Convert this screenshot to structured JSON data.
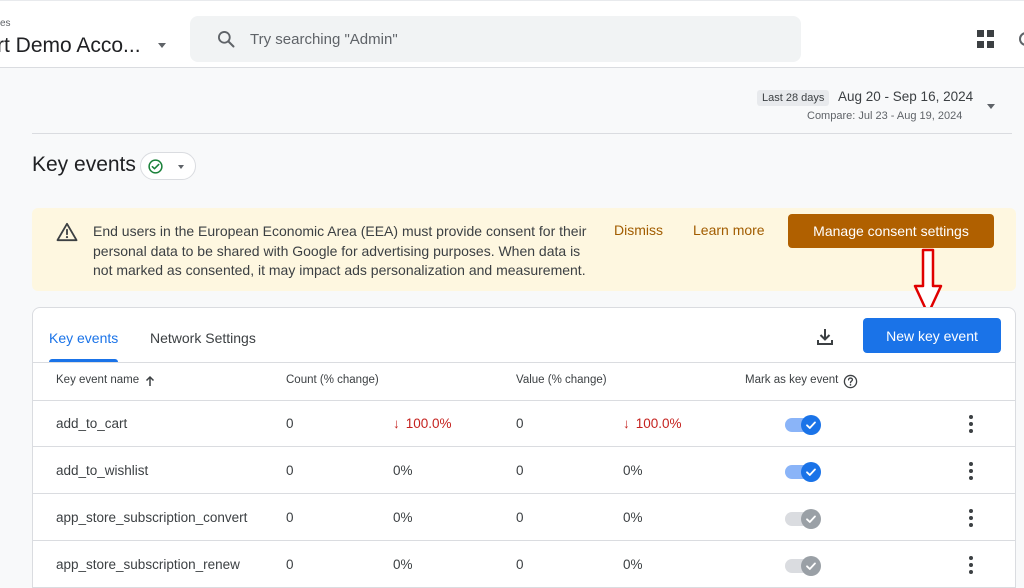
{
  "header": {
    "account_small": "es",
    "account_name": "rt Demo Acco...",
    "search_placeholder": "Try searching \"Admin\""
  },
  "date": {
    "chip": "Last 28 days",
    "range": "Aug 20 - Sep 16, 2024",
    "compare": "Compare: Jul 23 - Aug 19, 2024"
  },
  "page": {
    "title": "Key events"
  },
  "banner": {
    "text": "End users in the European Economic Area (EEA) must provide consent for their personal data to be shared with Google for advertising purposes. When data is not marked as consented, it may impact ads personalization and measurement.",
    "dismiss": "Dismiss",
    "learn_more": "Learn more",
    "manage": "Manage consent settings"
  },
  "tabs": {
    "key_events": "Key events",
    "network_settings": "Network Settings"
  },
  "new_button": "New key event",
  "table": {
    "headers": {
      "name": "Key event name",
      "count": "Count (% change)",
      "value": "Value (% change)",
      "mark": "Mark as key event"
    },
    "rows": [
      {
        "name": "add_to_cart",
        "count": "0",
        "count_change": "100.0%",
        "value": "0",
        "value_change": "100.0%",
        "negative": true,
        "marked": true
      },
      {
        "name": "add_to_wishlist",
        "count": "0",
        "count_change": "0%",
        "value": "0",
        "value_change": "0%",
        "negative": false,
        "marked": true
      },
      {
        "name": "app_store_subscription_convert",
        "count": "0",
        "count_change": "0%",
        "value": "0",
        "value_change": "0%",
        "negative": false,
        "marked": false
      },
      {
        "name": "app_store_subscription_renew",
        "count": "0",
        "count_change": "0%",
        "value": "0",
        "value_change": "0%",
        "negative": false,
        "marked": false
      }
    ]
  },
  "colors": {
    "primary": "#1a73e8",
    "warning_bg": "#fef7e0",
    "manage_button": "#b06000",
    "negative": "#c5221f",
    "annotation": "#e00000"
  }
}
